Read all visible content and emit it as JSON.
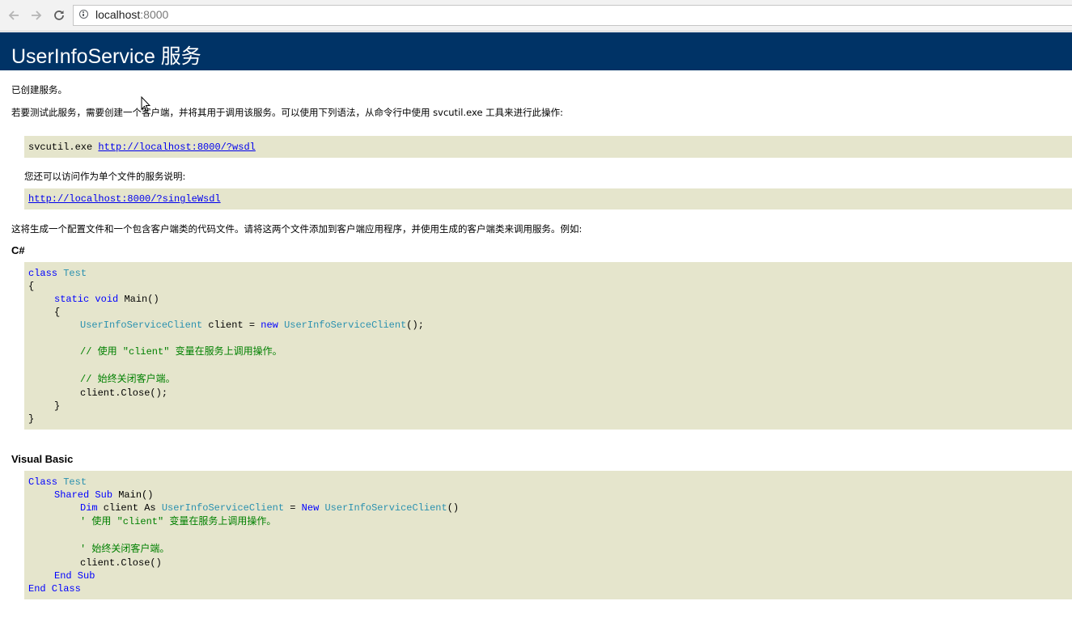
{
  "browser": {
    "url_host": "localhost",
    "url_port": ":8000"
  },
  "page": {
    "title": "UserInfoService 服务",
    "created": "已创建服务。",
    "intro": "若要测试此服务，需要创建一个客户端，并将其用于调用该服务。可以使用下列语法，从命令行中使用 svcutil.exe 工具来进行此操作:",
    "svcutil_cmd": "svcutil.exe ",
    "wsdl_link": "http://localhost:8000/?wsdl",
    "single_file_note": "您还可以访问作为单个文件的服务说明:",
    "single_wsdl_link": "http://localhost:8000/?singleWsdl",
    "generate_note": "这将生成一个配置文件和一个包含客户端类的代码文件。请将这两个文件添加到客户端应用程序，并使用生成的客户端类来调用服务。例如:",
    "csharp_title": "C#",
    "vb_title": "Visual Basic"
  },
  "csharp": {
    "l1_kw": "class",
    "l1_ty": "Test",
    "l2": "{",
    "l3_kw1": "static",
    "l3_kw2": "void",
    "l3_rest": "Main()",
    "l4": "{",
    "l5_ty1": "UserInfoServiceClient",
    "l5_mid": " client = ",
    "l5_kw": "new",
    "l5_ty2": "UserInfoServiceClient",
    "l5_end": "();",
    "l6_cm": "// 使用 \"client\" 变量在服务上调用操作。",
    "l7_cm": "// 始终关闭客户端。",
    "l8": "client.Close();",
    "l9": "}",
    "l10": "}"
  },
  "vb": {
    "l1_kw": "Class",
    "l1_ty": "Test",
    "l2_kw1": "Shared",
    "l2_kw2": "Sub",
    "l2_rest": "Main()",
    "l3_kw1": "Dim",
    "l3_mid": " client As ",
    "l3_ty1": "UserInfoServiceClient",
    "l3_eq": " = ",
    "l3_kw2": "New",
    "l3_ty2": "UserInfoServiceClient",
    "l3_end": "()",
    "l4_cm": "' 使用 \"client\" 变量在服务上调用操作。",
    "l5_cm": "' 始终关闭客户端。",
    "l6": "client.Close()",
    "l7_kw": "End Sub",
    "l8_kw": "End Class"
  }
}
